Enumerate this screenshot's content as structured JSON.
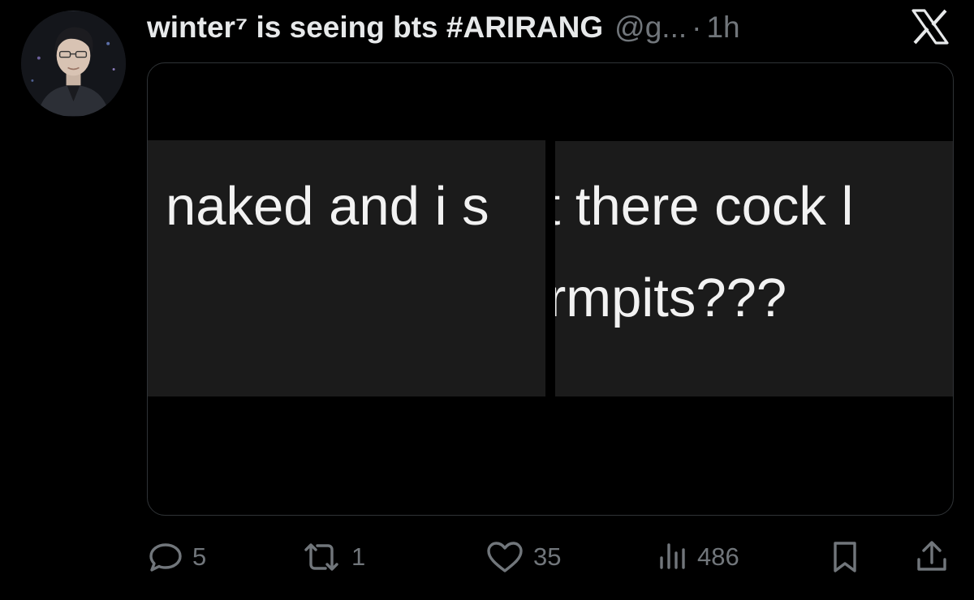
{
  "tweet": {
    "display_name": "winter⁷ is seeing bts #ARIRANG",
    "handle": "@g...",
    "separator": "·",
    "time": "1h"
  },
  "media": {
    "left_panel_text": "naked and i s",
    "right_panel_line1": "ıt there cock l",
    "right_panel_line2": "rmpits???"
  },
  "actions": {
    "replies": "5",
    "reposts": "1",
    "likes": "35",
    "views": "486"
  },
  "icons": {
    "reply": "speech-bubble",
    "repost": "arrows-loop",
    "like": "heart",
    "views": "bar-chart",
    "bookmark": "bookmark",
    "share": "upload-arrow",
    "brand": "x-logo"
  },
  "colors": {
    "background": "#000000",
    "text": "#e7e9ea",
    "muted": "#71767b",
    "border": "#2f3336",
    "panel": "#1b1b1b"
  }
}
